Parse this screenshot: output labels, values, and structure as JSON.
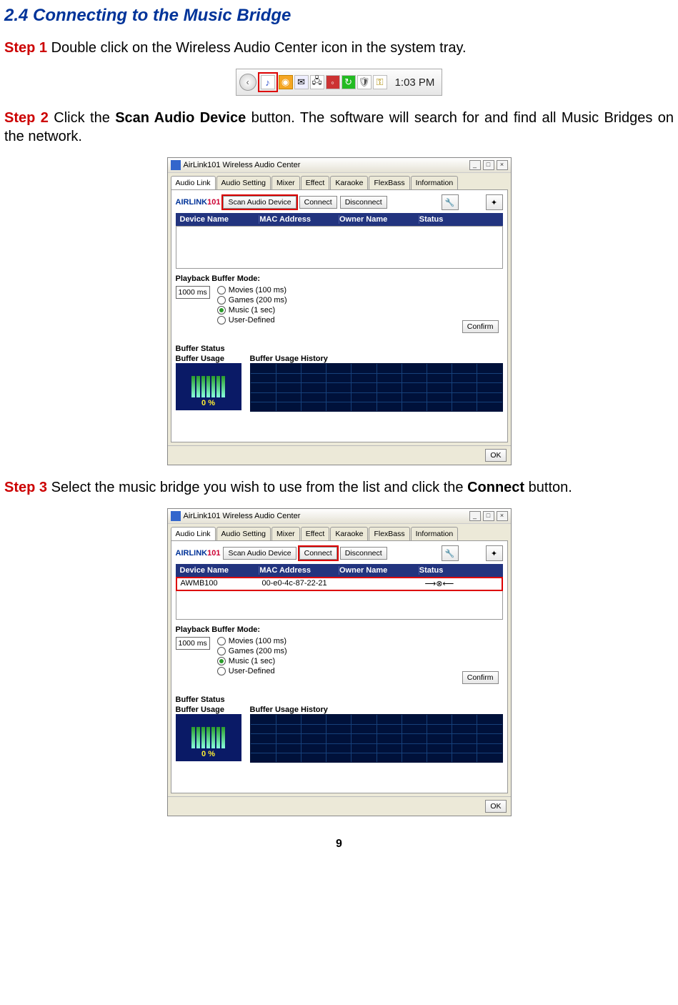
{
  "section_title": "2.4 Connecting to the Music Bridge",
  "step1": {
    "label": "Step 1",
    "text": " Double click on the Wireless Audio Center icon in the system tray."
  },
  "tray": {
    "clock": "1:03 PM",
    "icons": {
      "chevron": "‹",
      "note": "♪",
      "orange": "◉",
      "flag": "✉",
      "net": "🖧",
      "red": "◦",
      "green": "↻",
      "shield": "🛡",
      "key": "⚿"
    }
  },
  "step2": {
    "label": "Step 2",
    "pre": " Click the ",
    "bold": "Scan Audio Device",
    "post": " button.  The software will search for and find all Music Bridges on the network."
  },
  "step3": {
    "label": "Step 3",
    "pre": " Select the music bridge you wish to use from the list and click the ",
    "bold": "Connect",
    "post": " button."
  },
  "app": {
    "title": "AirLink101 Wireless Audio Center",
    "winbtns": {
      "min": "_",
      "max": "□",
      "close": "×"
    },
    "tabs": [
      "Audio Link",
      "Audio Setting",
      "Mixer",
      "Effect",
      "Karaoke",
      "FlexBass",
      "Information"
    ],
    "logo": {
      "pre": "AIRLINK",
      "suf": "101"
    },
    "buttons": {
      "scan": "Scan Audio Device",
      "connect": "Connect",
      "disconnect": "Disconnect"
    },
    "tool_icons": {
      "wrench": "🔧",
      "star": "✦"
    },
    "headers": [
      "Device Name",
      "MAC Address",
      "Owner Name",
      "Status"
    ],
    "row": {
      "device": "AWMB100",
      "mac": "00-e0-4c-87-22-21",
      "owner": "",
      "status": "⟶⊗⟵"
    },
    "playback_label": "Playback Buffer Mode:",
    "ms_label": "1000 ms",
    "radios": {
      "movies": "Movies (100 ms)",
      "games": "Games (200 ms)",
      "music": "Music (1 sec)",
      "user": "User-Defined"
    },
    "confirm": "Confirm",
    "buffer_status": "Buffer Status",
    "usage_label": "Buffer Usage",
    "history_label": "Buffer Usage History",
    "pct": "0 %",
    "ok": "OK"
  },
  "page_number": "9"
}
